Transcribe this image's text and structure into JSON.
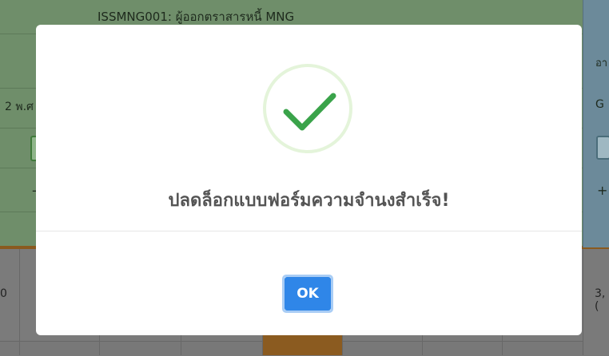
{
  "background": {
    "title": "ISSMNG001: ผู้ออกตราสารหนี้ MNG",
    "left_date_fragment": "2 พ.ศ",
    "right_header_fragment": "อา",
    "right_g_fragment": "G",
    "right_plus": "+",
    "left_dash": "-",
    "left_value_fragment": "0",
    "right_value_fragment": "3,("
  },
  "modal": {
    "icon": "success-check-icon",
    "message": "ปลดล็อกแบบฟอร์มความจำนงสำเร็จ!",
    "ok_label": "OK"
  },
  "colors": {
    "check": "#3aa34a",
    "ring": "#e3f2dc",
    "ok_button": "#2f86e8",
    "message_text": "#545454"
  }
}
